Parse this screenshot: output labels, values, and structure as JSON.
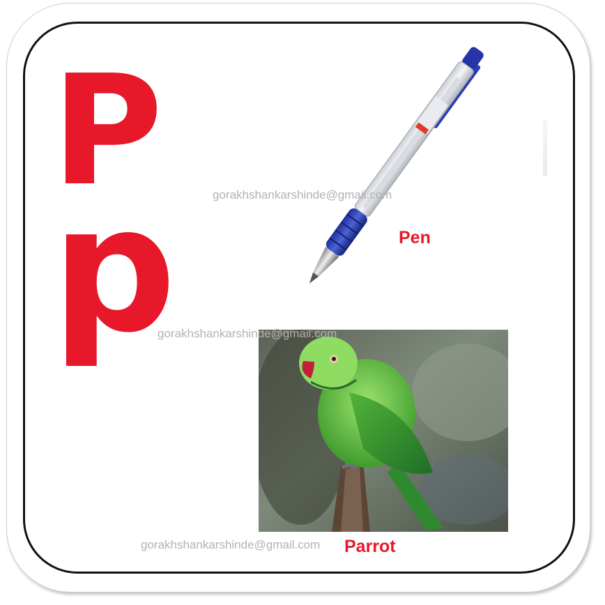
{
  "letters": {
    "upper": "P",
    "lower": "p"
  },
  "items": [
    {
      "label": "Pen",
      "icon": "pen-image"
    },
    {
      "label": "Parrot",
      "icon": "parrot-image"
    }
  ],
  "watermarks": [
    "gorakhshankarshinde@gmail.com",
    "gorakhshankarshinde@gmail.com",
    "gorakhshankarshinde@gmail.com"
  ],
  "colors": {
    "letter": "#e8182b",
    "label": "#e8182b",
    "border": "#111111",
    "watermark": "#b2b2b2"
  }
}
